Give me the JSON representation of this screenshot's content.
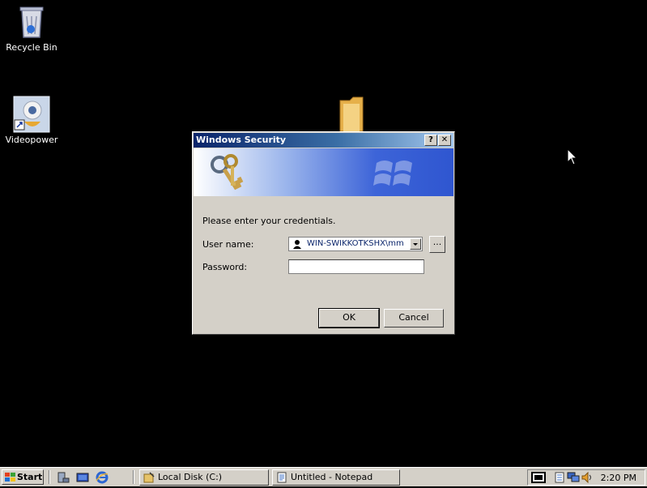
{
  "desktop": {
    "icons": [
      {
        "label": "Recycle Bin"
      },
      {
        "label": "Videopower"
      }
    ]
  },
  "dialog": {
    "title": "Windows Security",
    "help_btn": "?",
    "close_btn": "✕",
    "prompt": "Please enter your credentials.",
    "username_label": "User name:",
    "username_value": "WIN-SWIKKOTKSHX\\mm",
    "browse_label": "...",
    "password_label": "Password:",
    "password_value": "",
    "ok_label": "OK",
    "cancel_label": "Cancel"
  },
  "taskbar": {
    "start_label": "Start",
    "tasks": [
      {
        "label": "Local Disk (C:)"
      },
      {
        "label": "Untitled - Notepad"
      }
    ],
    "clock": "2:20 PM"
  }
}
